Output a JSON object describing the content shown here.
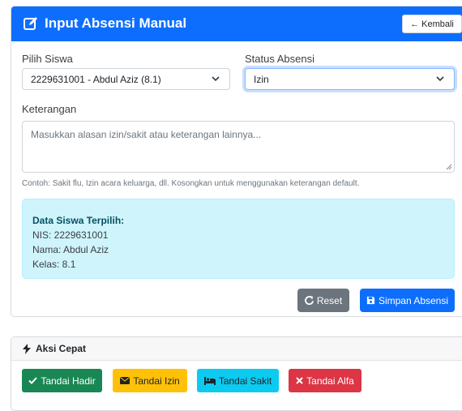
{
  "header": {
    "title": "Input Absensi Manual",
    "back_label": "Kembali"
  },
  "form": {
    "student_label": "Pilih Siswa",
    "student_value": "2229631001 - Abdul Aziz (8.1)",
    "status_label": "Status Absensi",
    "status_value": "Izin",
    "note_label": "Keterangan",
    "note_placeholder": "Masukkan alasan izin/sakit atau keterangan lainnya...",
    "note_help": "Contoh: Sakit flu, Izin acara keluarga, dll. Kosongkan untuk menggunakan keterangan default."
  },
  "selected": {
    "title": "Data Siswa Terpilih:",
    "nis": "NIS: 2229631001",
    "name": "Nama: Abdul Aziz",
    "class": "Kelas: 8.1"
  },
  "actions": {
    "reset_label": "Reset",
    "save_label": "Simpan Absensi"
  },
  "quick": {
    "title": "Aksi Cepat",
    "hadir": "Tandai Hadir",
    "izin": "Tandai Izin",
    "sakit": "Tandai Sakit",
    "alfa": "Tandai Alfa"
  },
  "colors": {
    "primary": "#0d6efd",
    "secondary": "#6c757d",
    "success": "#198754",
    "warning": "#ffc107",
    "info": "#0dcaf0",
    "danger": "#dc3545",
    "info_bg": "#cff4fc"
  }
}
